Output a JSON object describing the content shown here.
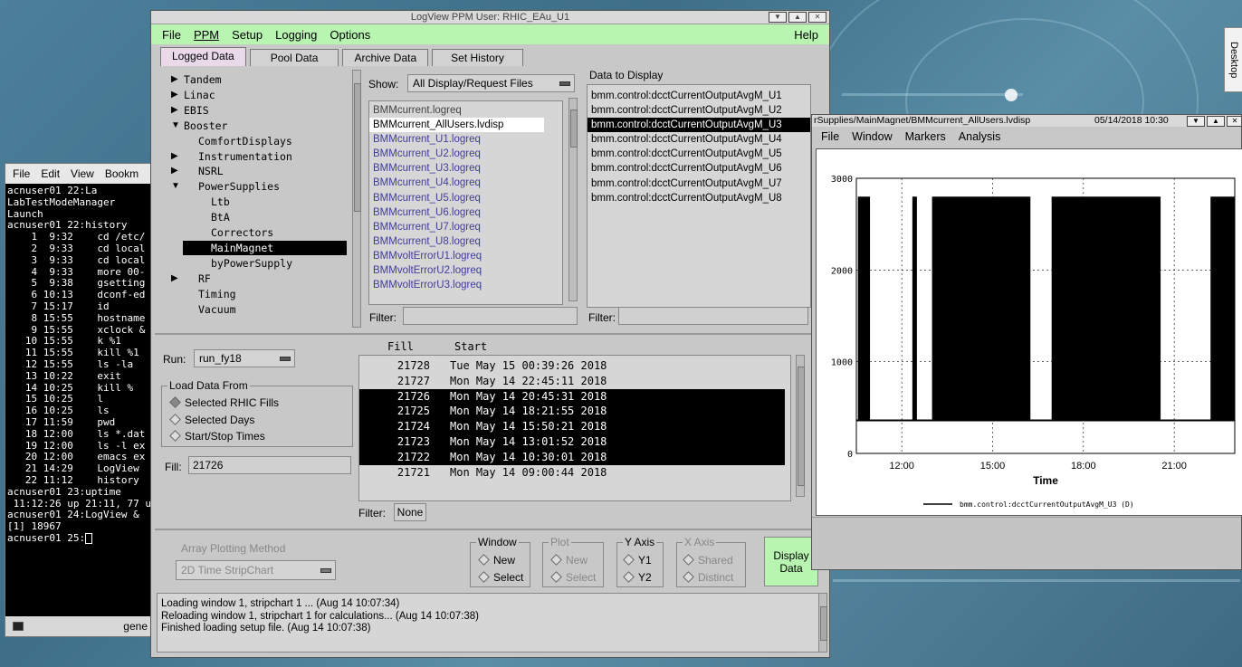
{
  "desktop_tab": {
    "label": "Desktop"
  },
  "terminal": {
    "menu": [
      "File",
      "Edit",
      "View",
      "Bookm"
    ],
    "lines": [
      "acnuser01 22:La",
      "LabTestModeManager",
      "Launch",
      "acnuser01 22:history",
      "    1  9:32    cd /etc/",
      "    2  9:33    cd local",
      "    3  9:33    cd local",
      "    4  9:33    more 00-",
      "    5  9:38    gsetting",
      "    6 10:13    dconf-ed",
      "    7 15:17    id",
      "    8 15:55    hostname",
      "    9 15:55    xclock &",
      "   10 15:55    k %1",
      "   11 15:55    kill %1",
      "   12 15:55    ls -la",
      "   13 10:22    exit",
      "   14 10:25    kill %",
      "   15 10:25    l",
      "   16 10:25    ls",
      "   17 11:59    pwd",
      "   18 12:00    ls *.dat",
      "   19 12:00    ls -l ex",
      "   20 12:00    emacs ex",
      "   21 14:29    LogView",
      "   22 11:12    history",
      "acnuser01 23:uptime",
      " 11:12:26 up 21:11, 77 u",
      "acnuser01 24:LogView &",
      "[1] 18967",
      "acnuser01 25:"
    ],
    "status_label": "gene"
  },
  "logview": {
    "title": "LogView    PPM User: RHIC_EAu_U1",
    "menu": [
      "File",
      "PPM",
      "Setup",
      "Logging",
      "Options"
    ],
    "help": "Help",
    "tabs": [
      "Logged Data",
      "Pool Data",
      "Archive Data",
      "Set History"
    ],
    "tree": [
      {
        "label": "Tandem",
        "arrow": "right",
        "level": 0
      },
      {
        "label": "Linac",
        "arrow": "right",
        "level": 0
      },
      {
        "label": "EBIS",
        "arrow": "right",
        "level": 0
      },
      {
        "label": "Booster",
        "arrow": "down",
        "level": 0
      },
      {
        "label": "ComfortDisplays",
        "arrow": "",
        "level": 1
      },
      {
        "label": "Instrumentation",
        "arrow": "right",
        "level": 1
      },
      {
        "label": "NSRL",
        "arrow": "right",
        "level": 1
      },
      {
        "label": "PowerSupplies",
        "arrow": "down",
        "level": 1
      },
      {
        "label": "Ltb",
        "arrow": "",
        "level": 2
      },
      {
        "label": "BtA",
        "arrow": "",
        "level": 2
      },
      {
        "label": "Correctors",
        "arrow": "",
        "level": 2
      },
      {
        "label": "MainMagnet",
        "arrow": "",
        "level": 2,
        "selected": true
      },
      {
        "label": "byPowerSupply",
        "arrow": "",
        "level": 2
      },
      {
        "label": "RF",
        "arrow": "right",
        "level": 1
      },
      {
        "label": "Timing",
        "arrow": "",
        "level": 1
      },
      {
        "label": "Vacuum",
        "arrow": "",
        "level": 1
      }
    ],
    "show_label": "Show:",
    "show_value": "All Display/Request Files",
    "files": [
      {
        "name": "BMMcurrent.logreq",
        "style": "grey"
      },
      {
        "name": "BMMcurrent_AllUsers.lvdisp",
        "style": "white"
      },
      {
        "name": "BMMcurrent_U1.logreq",
        "style": "purple"
      },
      {
        "name": "BMMcurrent_U2.logreq",
        "style": "purple"
      },
      {
        "name": "BMMcurrent_U3.logreq",
        "style": "purple"
      },
      {
        "name": "BMMcurrent_U4.logreq",
        "style": "purple"
      },
      {
        "name": "BMMcurrent_U5.logreq",
        "style": "purple"
      },
      {
        "name": "BMMcurrent_U6.logreq",
        "style": "purple"
      },
      {
        "name": "BMMcurrent_U7.logreq",
        "style": "purple"
      },
      {
        "name": "BMMcurrent_U8.logreq",
        "style": "purple"
      },
      {
        "name": "BMMvoltErrorU1.logreq",
        "style": "purple"
      },
      {
        "name": "BMMvoltErrorU2.logreq",
        "style": "purple"
      },
      {
        "name": "BMMvoltErrorU3.logreq",
        "style": "purple"
      }
    ],
    "data_to_display_label": "Data to Display",
    "data_items": [
      {
        "name": "bmm.control:dcctCurrentOutputAvgM_U1"
      },
      {
        "name": "bmm.control:dcctCurrentOutputAvgM_U2"
      },
      {
        "name": "bmm.control:dcctCurrentOutputAvgM_U3",
        "selected": true
      },
      {
        "name": "bmm.control:dcctCurrentOutputAvgM_U4"
      },
      {
        "name": "bmm.control:dcctCurrentOutputAvgM_U5"
      },
      {
        "name": "bmm.control:dcctCurrentOutputAvgM_U6"
      },
      {
        "name": "bmm.control:dcctCurrentOutputAvgM_U7"
      },
      {
        "name": "bmm.control:dcctCurrentOutputAvgM_U8"
      }
    ],
    "filter_label": "Filter:",
    "run_label": "Run:",
    "run_value": "run_fy18",
    "load_from_label": "Load Data From",
    "load_options": [
      "Selected RHIC Fills",
      "Selected Days",
      "Start/Stop Times"
    ],
    "fill_label": "Fill:",
    "fill_value": "21726",
    "fills_header": {
      "fill": "Fill",
      "start": "Start"
    },
    "fills": [
      {
        "fill": "21728",
        "start": "Tue May 15 00:39:26 2018",
        "selected": false
      },
      {
        "fill": "21727",
        "start": "Mon May 14 22:45:11 2018",
        "selected": false
      },
      {
        "fill": "21726",
        "start": "Mon May 14 20:45:31 2018",
        "selected": true
      },
      {
        "fill": "21725",
        "start": "Mon May 14 18:21:55 2018",
        "selected": true
      },
      {
        "fill": "21724",
        "start": "Mon May 14 15:50:21 2018",
        "selected": true
      },
      {
        "fill": "21723",
        "start": "Mon May 14 13:01:52 2018",
        "selected": true
      },
      {
        "fill": "21722",
        "start": "Mon May 14 10:30:01 2018",
        "selected": true
      },
      {
        "fill": "21721",
        "start": "Mon May 14 09:00:44 2018",
        "selected": false
      }
    ],
    "fill_filter_value": "None",
    "array_plot_label": "Array Plotting Method",
    "array_plot_value": "2D Time StripChart",
    "window_group": {
      "title": "Window",
      "options": [
        "New",
        "Select"
      ]
    },
    "plot_group": {
      "title": "Plot",
      "options": [
        "New",
        "Select"
      ]
    },
    "yaxis_group": {
      "title": "Y Axis",
      "options": [
        "Y1",
        "Y2"
      ]
    },
    "xaxis_group": {
      "title": "X Axis",
      "options": [
        "Shared",
        "Distinct"
      ]
    },
    "display_button": {
      "line1": "Display",
      "line2": "Data"
    },
    "status_lines": [
      "Loading window 1, stripchart 1 ... (Aug 14 10:07:34)",
      "Reloading window 1, stripchart 1 for calculations... (Aug 14 10:07:38)",
      "Finished loading setup file. (Aug 14 10:07:38)"
    ]
  },
  "plot_window": {
    "title": "rSupplies/MainMagnet/BMMcurrent_AllUsers.lvdisp",
    "date": "05/14/2018 10:30",
    "menu": [
      "File",
      "Window",
      "Markers",
      "Analysis"
    ]
  },
  "chart_data": {
    "type": "line",
    "title": "",
    "xlabel": "Time",
    "ylabel": "",
    "ylim": [
      0,
      3000
    ],
    "yticks": [
      "0",
      "1000",
      "2000",
      "3000"
    ],
    "xticks": [
      "12:00",
      "15:00",
      "18:00",
      "21:00"
    ],
    "xlim_hours": [
      10.5,
      23.0
    ],
    "grid": true,
    "legend": "bmm.control:dcctCurrentOutputAvgM_U3 (D)",
    "legend_position": "bottom",
    "series_color": "#000000",
    "high_value": 2800,
    "low_value": 360,
    "filled_segments_hours": [
      [
        10.55,
        10.95
      ],
      [
        12.4,
        12.5
      ],
      [
        13.0,
        16.25
      ],
      [
        16.95,
        20.55
      ],
      [
        22.2,
        23.0
      ]
    ],
    "spikes_hours": [
      12.35
    ]
  }
}
